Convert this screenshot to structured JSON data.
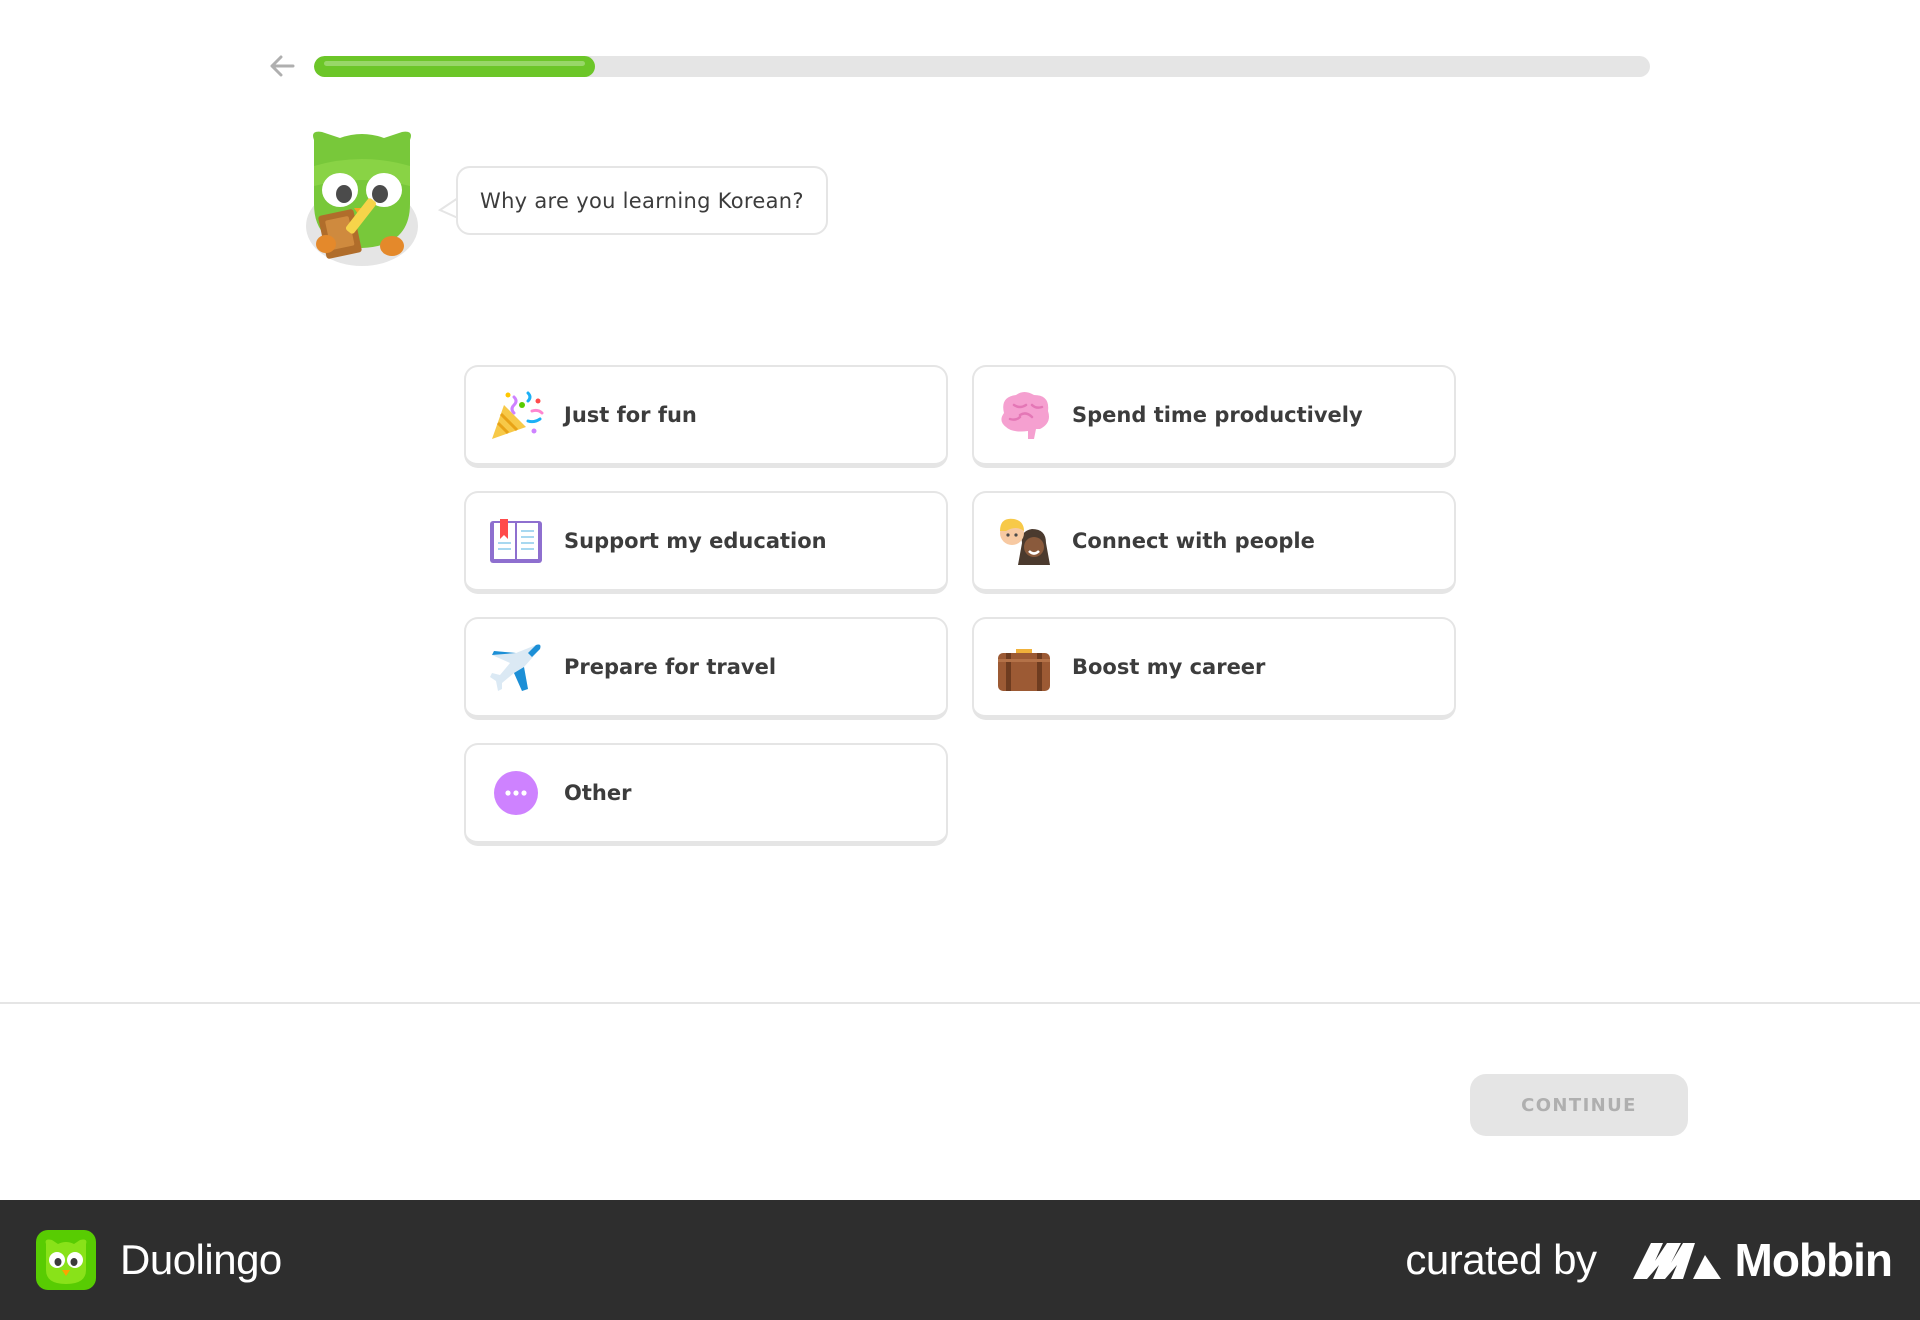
{
  "progress": {
    "fraction": 0.21
  },
  "mascot": {
    "icon": "duo-owl-icon"
  },
  "question": {
    "text": "Why are you learning Korean?"
  },
  "options": [
    {
      "label": "Just for fun",
      "icon": "party-popper-icon"
    },
    {
      "label": "Spend time productively",
      "icon": "brain-icon"
    },
    {
      "label": "Support my education",
      "icon": "book-icon"
    },
    {
      "label": "Connect with people",
      "icon": "people-icon"
    },
    {
      "label": "Prepare for travel",
      "icon": "airplane-icon"
    },
    {
      "label": "Boost my career",
      "icon": "briefcase-icon"
    },
    {
      "label": "Other",
      "icon": "more-dots-icon"
    }
  ],
  "footer": {
    "continue_label": "CONTINUE"
  },
  "branding": {
    "app_name": "Duolingo",
    "curated_by": "curated by",
    "curator": "Mobbin"
  },
  "colors": {
    "accent": "#6cc628",
    "border": "#e5e5e5",
    "text": "#3c3c3c",
    "disabled_text": "#afafaf",
    "brand_bar": "#2e2e2e"
  }
}
